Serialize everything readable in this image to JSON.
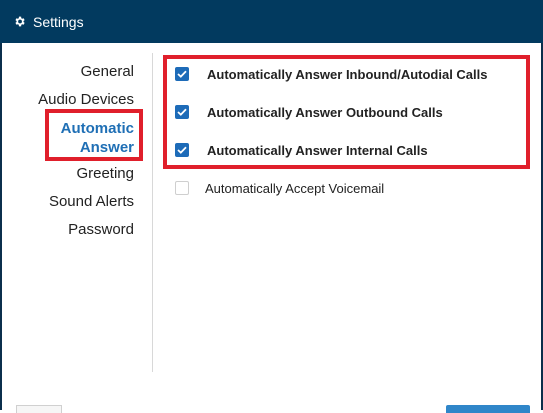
{
  "window": {
    "title": "Settings",
    "icon": "gear-icon"
  },
  "nav": {
    "items": [
      {
        "label": "General"
      },
      {
        "label": "Audio Devices"
      },
      {
        "label_line1": "Automatic",
        "label_line2": "Answer",
        "active": true
      },
      {
        "label": "Greeting"
      },
      {
        "label": "Sound Alerts"
      },
      {
        "label": "Password"
      }
    ]
  },
  "options": [
    {
      "label": "Automatically Answer Inbound/Autodial Calls",
      "checked": true
    },
    {
      "label": "Automatically Answer Outbound Calls",
      "checked": true
    },
    {
      "label": "Automatically Answer Internal Calls",
      "checked": true
    },
    {
      "label": "Automatically Accept Voicemail",
      "checked": false
    }
  ],
  "colors": {
    "titlebar": "#023a5f",
    "active_nav": "#1f6fb5",
    "checkbox": "#1d6bb8",
    "highlight": "#e01f2b"
  }
}
